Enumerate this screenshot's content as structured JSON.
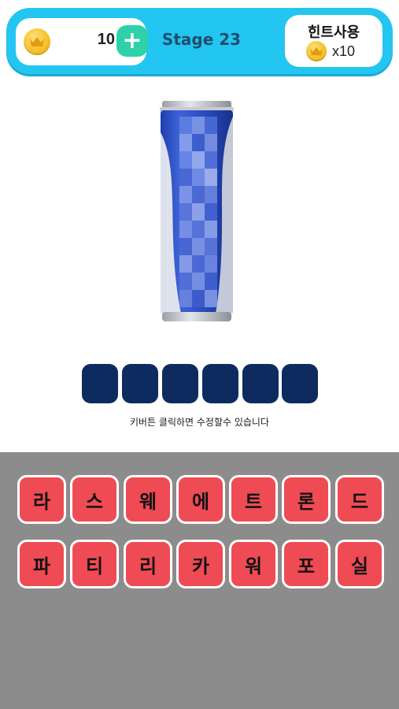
{
  "header": {
    "coin_count": "10",
    "plus_symbol": "+",
    "stage_title": "Stage 23",
    "hint_label": "힌트사용",
    "hint_cost": "x10",
    "coin_icon": "crown-coin-icon"
  },
  "colors": {
    "header_bg": "#22c6f0",
    "plus_button": "#2ed1a8",
    "answer_slot": "#0d2b5e",
    "key_bg": "#ef4b55",
    "keyboard_bg": "#8c8c8c"
  },
  "puzzle": {
    "image": "blue-soda-can-blurred-label",
    "slot_count": 6,
    "instructions": "키버튼 클릭하면 수정할수 있습니다"
  },
  "keyboard": {
    "rows": [
      [
        "라",
        "스",
        "웨",
        "에",
        "트",
        "론",
        "드"
      ],
      [
        "파",
        "티",
        "리",
        "카",
        "워",
        "포",
        "실"
      ]
    ]
  }
}
